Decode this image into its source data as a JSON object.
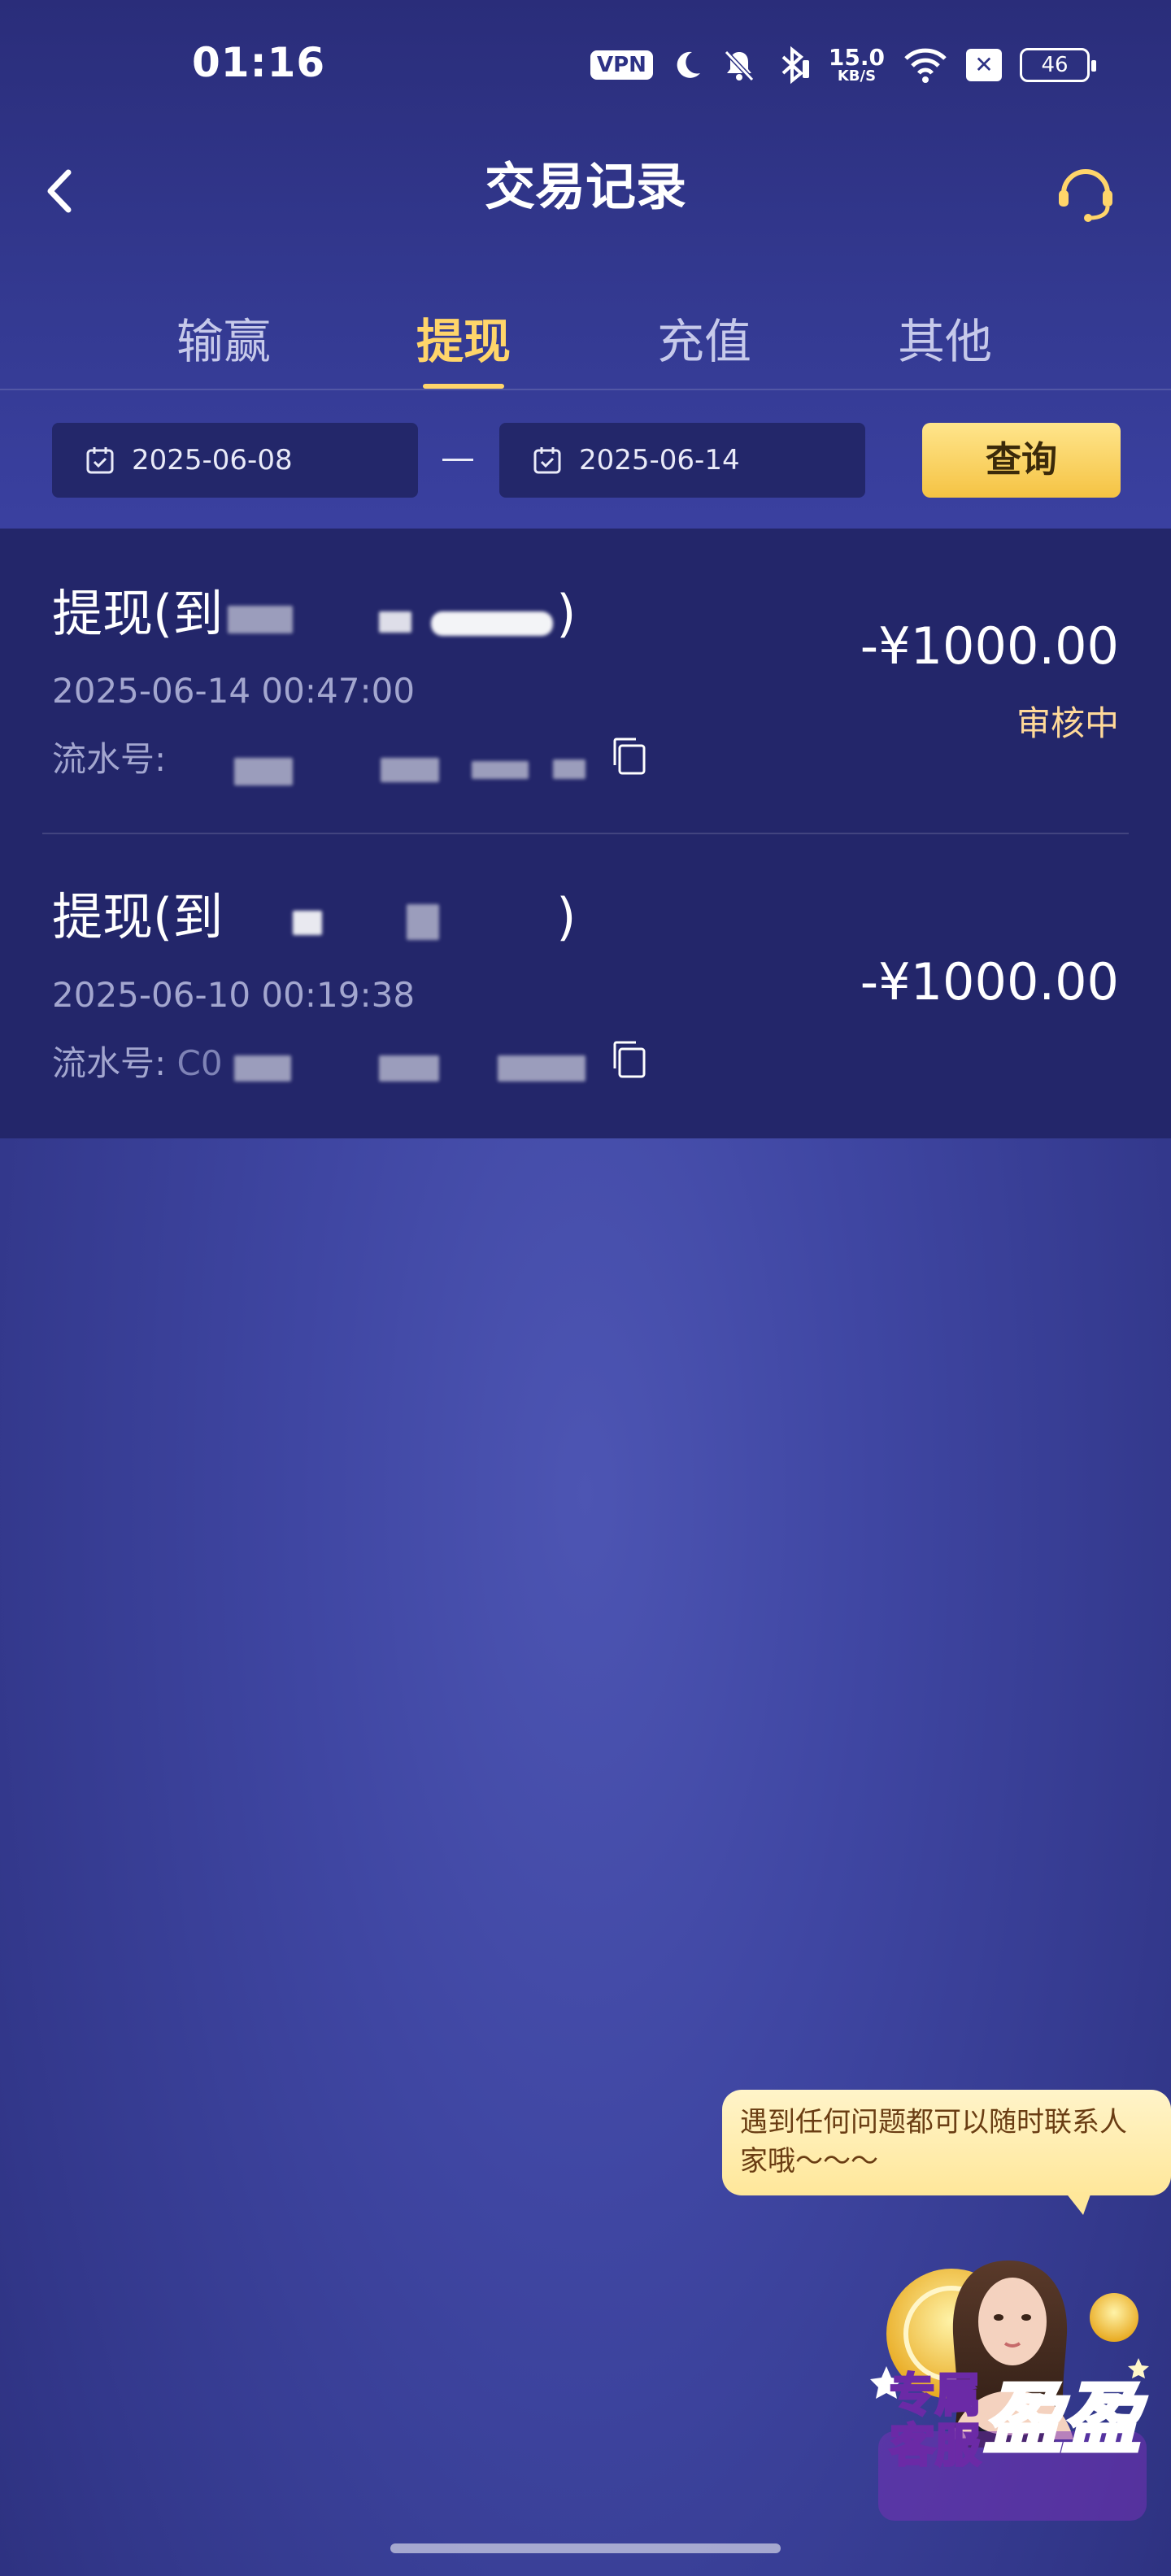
{
  "status_bar": {
    "time": "01:16",
    "vpn": "VPN",
    "net_speed_value": "15.0",
    "net_speed_unit": "KB/S",
    "battery": "46",
    "icons": [
      "vpn-badge",
      "moon-icon",
      "bell-off-icon",
      "bluetooth-icon",
      "net-speed",
      "wifi-icon",
      "x-box-icon",
      "battery-icon"
    ]
  },
  "nav": {
    "title": "交易记录",
    "back_icon": "chevron-left-icon",
    "support_icon": "headset-icon"
  },
  "tabs": [
    {
      "label": "输赢",
      "active": false
    },
    {
      "label": "提现",
      "active": true
    },
    {
      "label": "充值",
      "active": false
    },
    {
      "label": "其他",
      "active": false
    }
  ],
  "filter": {
    "start_date": "2025-06-08",
    "end_date": "2025-06-14",
    "separator": "—",
    "query_label": "查询"
  },
  "records": [
    {
      "title": "提现(到",
      "title_close": ")",
      "datetime": "2025-06-14 00:47:00",
      "serial_label": "流水号:",
      "amount": "-¥1000.00",
      "status": "审核中"
    },
    {
      "title": "提现(到",
      "title_close": ")",
      "datetime": "2025-06-10 00:19:38",
      "serial_label": "流水号:",
      "serial_visible": "C0",
      "amount": "-¥1000.00",
      "status": ""
    }
  ],
  "service": {
    "bubble_text": "遇到任何问题都可以随时联系人家哦～～～",
    "badge_line1": "专属",
    "badge_line2": "客服",
    "badge_name": "盈盈"
  },
  "colors": {
    "accent": "#ffd56a",
    "status_pending": "#ffd999",
    "list_bg": "#23266a"
  }
}
